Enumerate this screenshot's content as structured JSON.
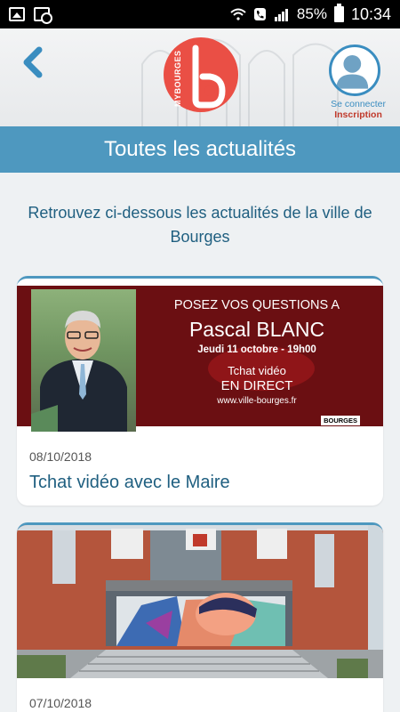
{
  "status_bar": {
    "battery": "85%",
    "time": "10:34"
  },
  "header": {
    "logo_text": "MYBOURGES",
    "login_line1": "Se connecter",
    "login_line2": "Inscription"
  },
  "page": {
    "title": "Toutes les actualités",
    "intro": "Retrouvez ci-dessous les actualités de la ville de Bourges"
  },
  "articles": [
    {
      "date": "08/10/2018",
      "title": "Tchat vidéo avec le Maire",
      "banner": {
        "line1": "POSEZ VOS QUESTIONS A",
        "line2": "Pascal BLANC",
        "line3": "Jeudi 11 octobre - 19h00",
        "line4": "Tchat vidéo",
        "line5": "EN DIRECT",
        "line6": "www.ville-bourges.fr",
        "badge": "BOURGES"
      }
    },
    {
      "date": "07/10/2018",
      "title": ""
    }
  ],
  "colors": {
    "accent": "#4e98bf",
    "brand_red": "#ea4f45",
    "banner": "#6b0f12"
  }
}
